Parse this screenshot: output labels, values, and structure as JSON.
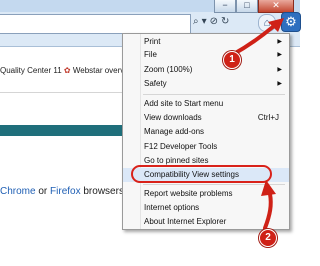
{
  "browser": {
    "window_controls": {
      "minimize": "−",
      "restore": "□",
      "close": "✕"
    },
    "address_tools": [
      "⌕",
      "▾",
      "⊘",
      "↻"
    ],
    "home_glyph": "⌂",
    "favorites_glyph": "☆",
    "gear_glyph": "⚙"
  },
  "page": {
    "favorites_line": {
      "item1": "Quality Center 11",
      "item2": "Webstar overv"
    },
    "browsers_text": {
      "chrome": "Chrome",
      "or": " or ",
      "firefox": "Firefox",
      "rest": " browsers"
    }
  },
  "menu": {
    "items": [
      {
        "label": "Print",
        "submenu": "▶"
      },
      {
        "label": "File",
        "submenu": "▶"
      },
      {
        "label": "Zoom (100%)",
        "submenu": "▶"
      },
      {
        "label": "Safety",
        "submenu": "▶"
      },
      {
        "label": "Add site to Start menu"
      },
      {
        "label": "View downloads",
        "shortcut": "Ctrl+J"
      },
      {
        "label": "Manage add-ons"
      },
      {
        "label": "F12 Developer Tools"
      },
      {
        "label": "Go to pinned sites"
      },
      {
        "label": "Compatibility View settings"
      },
      {
        "label": "Report website problems"
      },
      {
        "label": "Internet options"
      },
      {
        "label": "About Internet Explorer"
      }
    ]
  },
  "annotations": {
    "badge1": "1",
    "badge2": "2",
    "color": "#cf2117"
  }
}
